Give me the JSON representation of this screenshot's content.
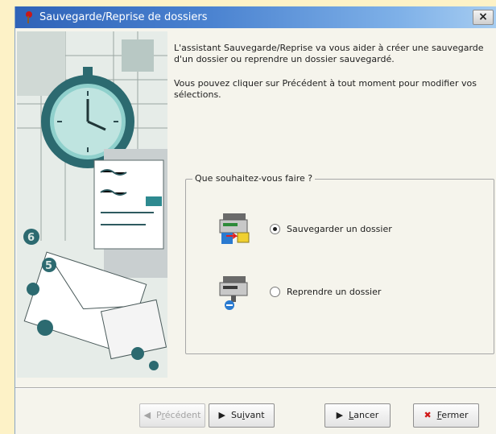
{
  "window": {
    "title": "Sauvegarde/Reprise de dossiers",
    "close_label": "×"
  },
  "intro": {
    "line1": "L'assistant Sauvegarde/Reprise va vous aider à créer une sauvegarde d'un dossier ou reprendre un dossier sauvegardé.",
    "line2": "Vous pouvez cliquer sur Précédent à tout moment pour modifier vos sélections."
  },
  "group": {
    "legend": "Que souhaitez-vous faire ?",
    "options": [
      {
        "label": "Sauvegarder un dossier",
        "checked": true,
        "icon": "backup-folder-icon"
      },
      {
        "label": "Reprendre un dossier",
        "checked": false,
        "icon": "restore-folder-icon"
      }
    ]
  },
  "buttons": {
    "previous": {
      "label_first": "P",
      "label_access": "r",
      "label_rest": "écédent",
      "enabled": false,
      "icon": "arrow-left-icon"
    },
    "next": {
      "label_first": "Su",
      "label_access": "i",
      "label_rest": "vant",
      "enabled": true,
      "icon": "arrow-right-icon"
    },
    "launch": {
      "label_first": "",
      "label_access": "L",
      "label_rest": "ancer",
      "enabled": true,
      "icon": "play-icon"
    },
    "close": {
      "label_first": "",
      "label_access": "F",
      "label_rest": "ermer",
      "enabled": true,
      "icon": "close-x-icon"
    }
  },
  "colors": {
    "title_bar_start": "#2f63b8",
    "title_bar_end": "#a7cdf1",
    "page_background": "#fdf2c7",
    "close_x": "#d01818"
  }
}
